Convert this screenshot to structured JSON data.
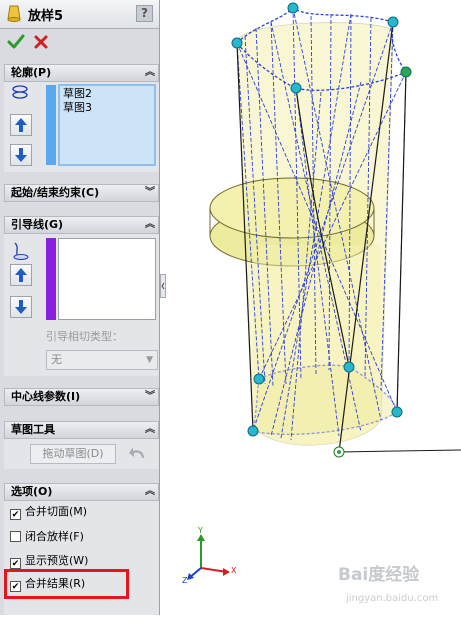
{
  "property_manager": {
    "title": "放样5",
    "help": "?",
    "ok_label": "✔",
    "cancel_label": "✖",
    "sections": {
      "profile": {
        "header": "轮廓(P)",
        "items": [
          "草图2",
          "草图3"
        ]
      },
      "start_end": {
        "header": "起始/结束约束(C)"
      },
      "guides": {
        "header": "引导线(G)",
        "tangency_label": "引导相切类型：",
        "tangency_value": "无"
      },
      "centerline": {
        "header": "中心线参数(I)"
      },
      "sketch_tools": {
        "header": "草图工具",
        "drag_label": "拖动草图(D)"
      },
      "options": {
        "header": "选项(O)",
        "items": [
          {
            "label": "合并切面(M)",
            "checked": true
          },
          {
            "label": "闭合放样(F)",
            "checked": false
          },
          {
            "label": "显示预览(W)",
            "checked": true
          },
          {
            "label": "合并结果(R)",
            "checked": true
          }
        ]
      }
    }
  },
  "viewport": {
    "triad_labels": {
      "y": "Y",
      "x": "X",
      "z": "Z"
    }
  },
  "watermark": {
    "main": "Bai度经验",
    "sub": "jingyan.baidu.com"
  },
  "colors": {
    "accent_highlight": "#e8141b",
    "ok_green": "#2e9a2e",
    "cancel_red": "#d02020",
    "wire_blue": "#2a3fd8",
    "body_yellow": "#f3efa0"
  }
}
